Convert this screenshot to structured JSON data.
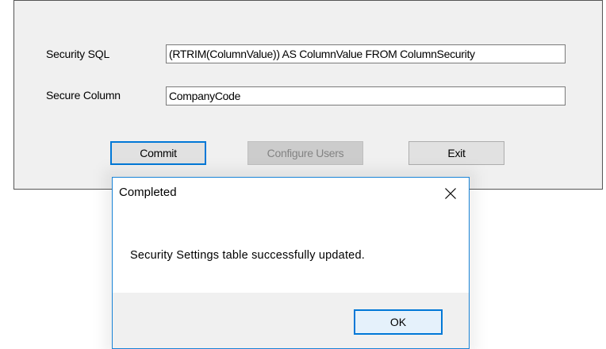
{
  "form": {
    "security_sql_label": "Security SQL",
    "security_sql_value": "(RTRIM(ColumnValue)) AS ColumnValue FROM ColumnSecurity",
    "secure_column_label": "Secure Column",
    "secure_column_value": "CompanyCode",
    "buttons": {
      "commit": "Commit",
      "configure_users": "Configure Users",
      "exit": "Exit"
    }
  },
  "dialog": {
    "title": "Completed",
    "close_icon": "close-icon",
    "message": "Security Settings table successfully updated.",
    "ok_label": "OK"
  },
  "colors": {
    "accent": "#0078d7",
    "form_background": "#f0f0f0",
    "dialog_border": "#1883d7"
  }
}
